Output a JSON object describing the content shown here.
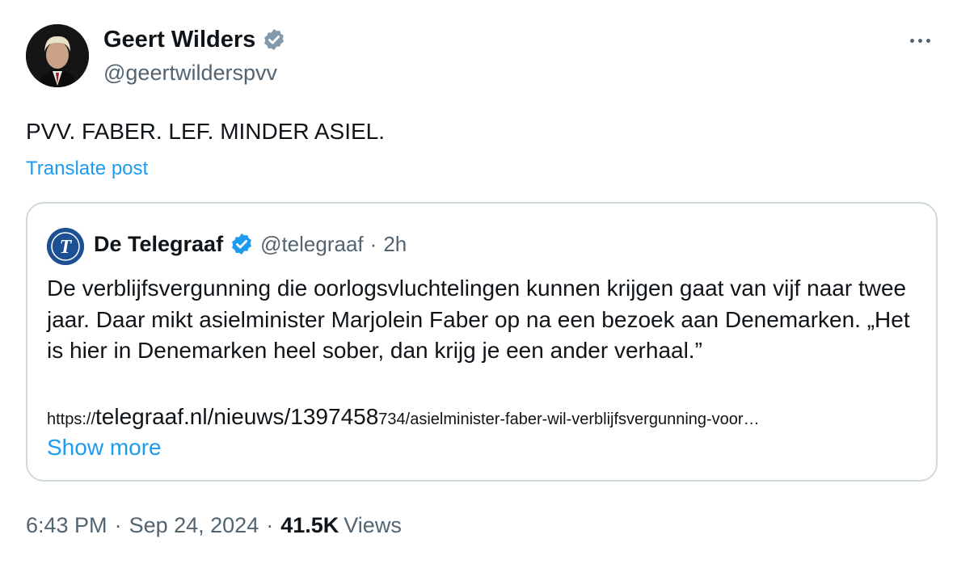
{
  "tweet": {
    "author": {
      "name": "Geert Wilders",
      "handle": "@geertwilderspvv",
      "avatar": "avatar-photo",
      "verified_icon": "verified-badge-icon",
      "verified_color": "#829aab"
    },
    "more_icon": "more-dots-icon",
    "text": "PVV. FABER. LEF. MINDER ASIEL.",
    "translate_label": "Translate post",
    "quote": {
      "name": "De Telegraaf",
      "handle": "@telegraaf",
      "separator": "·",
      "time": "2h",
      "avatar": "telegraaf-logo",
      "verified_color": "#1d9bf0",
      "body": "De verblijfsvergunning die oorlogsvluchtelingen kunnen krijgen gaat van vijf naar twee jaar. Daar mikt asielminister Marjolein Faber op na een bezoek aan Denemarken. „Het is hier in Denemarken heel sober, dan krijg je een ander verhaal.”",
      "link_prefix": "https://",
      "link_main": "telegraaf.nl/nieuws/1397458",
      "link_rest": "734/asielminister-faber-wil-verblijfsvergunning-voor…",
      "show_more": "Show more"
    },
    "meta": {
      "time": "6:43 PM",
      "sep1": "·",
      "date": "Sep 24, 2024",
      "sep2": "·",
      "views_count": "41.5K",
      "views_label": "Views"
    }
  },
  "colors": {
    "link": "#1d9bf0",
    "secondary_text": "#536471",
    "border": "#cfd9de"
  }
}
